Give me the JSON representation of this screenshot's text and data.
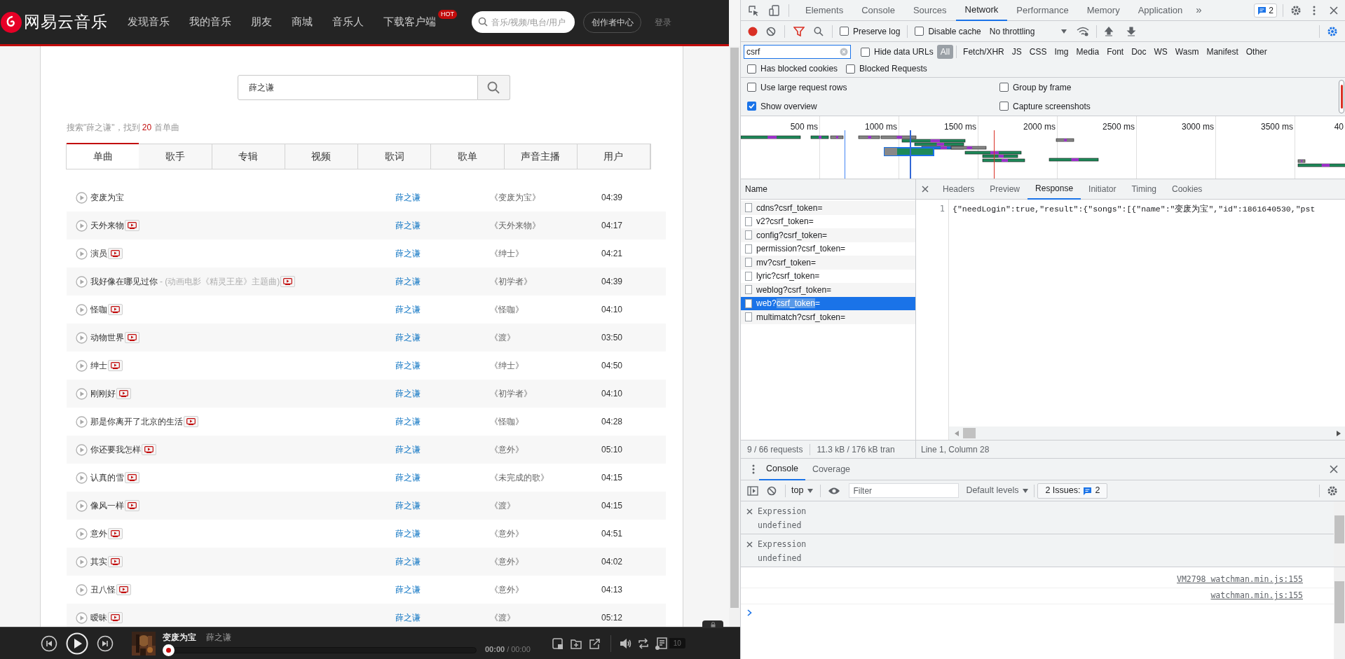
{
  "music_site": {
    "logo": "网易云音乐",
    "nav": [
      {
        "label": "发现音乐"
      },
      {
        "label": "我的音乐"
      },
      {
        "label": "朋友"
      },
      {
        "label": "商城"
      },
      {
        "label": "音乐人"
      },
      {
        "label": "下载客户端",
        "badge": "HOT"
      }
    ],
    "search_placeholder": "音乐/视频/电台/用户",
    "creator_button": "创作者中心",
    "login": "登录"
  },
  "search": {
    "value": "薛之谦",
    "summary_before": "搜索\"薛之谦\"，找到",
    "count": "20",
    "summary_after": "首单曲"
  },
  "result_tabs": [
    {
      "label": "单曲",
      "selected": true
    },
    {
      "label": "歌手",
      "selected": false
    },
    {
      "label": "专辑",
      "selected": false
    },
    {
      "label": "视频",
      "selected": false
    },
    {
      "label": "歌词",
      "selected": false
    },
    {
      "label": "歌单",
      "selected": false
    },
    {
      "label": "声音主播",
      "selected": false
    },
    {
      "label": "用户",
      "selected": false
    }
  ],
  "songs": [
    {
      "name": "变废为宝",
      "mv": false,
      "artist": "薛之谦",
      "album": "《变废为宝》",
      "duration": "04:39"
    },
    {
      "name": "天外来物",
      "mv": true,
      "artist": "薛之谦",
      "album": "《天外来物》",
      "duration": "04:17"
    },
    {
      "name": "演员",
      "mv": true,
      "artist": "薛之谦",
      "album": "《绅士》",
      "duration": "04:21"
    },
    {
      "name": "我好像在哪见过你",
      "note": "- (动画电影《精灵王座》主题曲)",
      "mv": true,
      "artist": "薛之谦",
      "album": "《初学者》",
      "duration": "04:39"
    },
    {
      "name": "怪咖",
      "mv": true,
      "artist": "薛之谦",
      "album": "《怪咖》",
      "duration": "04:10"
    },
    {
      "name": "动物世界",
      "mv": true,
      "artist": "薛之谦",
      "album": "《渡》",
      "duration": "03:50"
    },
    {
      "name": "绅士",
      "mv": true,
      "artist": "薛之谦",
      "album": "《绅士》",
      "duration": "04:50"
    },
    {
      "name": "刚刚好",
      "mv": true,
      "artist": "薛之谦",
      "album": "《初学者》",
      "duration": "04:10"
    },
    {
      "name": "那是你离开了北京的生活",
      "mv": true,
      "artist": "薛之谦",
      "album": "《怪咖》",
      "duration": "04:28"
    },
    {
      "name": "你还要我怎样",
      "mv": true,
      "artist": "薛之谦",
      "album": "《意外》",
      "duration": "05:10"
    },
    {
      "name": "认真的雪",
      "mv": true,
      "artist": "薛之谦",
      "album": "《未完成的歌》",
      "duration": "04:15"
    },
    {
      "name": "像风一样",
      "mv": true,
      "artist": "薛之谦",
      "album": "《渡》",
      "duration": "04:15"
    },
    {
      "name": "意外",
      "mv": true,
      "artist": "薛之谦",
      "album": "《意外》",
      "duration": "04:51"
    },
    {
      "name": "其实",
      "mv": true,
      "artist": "薛之谦",
      "album": "《意外》",
      "duration": "04:02"
    },
    {
      "name": "丑八怪",
      "mv": true,
      "artist": "薛之谦",
      "album": "《意外》",
      "duration": "04:13"
    },
    {
      "name": "暧昧",
      "mv": true,
      "artist": "薛之谦",
      "album": "《渡》",
      "duration": "05:12"
    }
  ],
  "player": {
    "title": "变废为宝",
    "artist": "薛之谦",
    "level": 0,
    "time_elapsed": "00:00",
    "time_total": "/ 00:00",
    "playlist_count": "10"
  },
  "devtools": {
    "tabs": [
      {
        "label": "Elements",
        "selected": false
      },
      {
        "label": "Console",
        "selected": false
      },
      {
        "label": "Sources",
        "selected": false
      },
      {
        "label": "Network",
        "selected": true
      },
      {
        "label": "Performance",
        "selected": false
      },
      {
        "label": "Memory",
        "selected": false
      },
      {
        "label": "Application",
        "selected": false
      }
    ],
    "more": "»",
    "issues_count": "2",
    "preserve_log": {
      "label": "Preserve log",
      "checked": false
    },
    "disable_cache": {
      "label": "Disable cache",
      "checked": false
    },
    "throttling": "No throttling",
    "filter": "csrf",
    "hide_data_urls": {
      "label": "Hide data URLs",
      "checked": false
    },
    "types": [
      {
        "label": "All",
        "selected": true
      },
      {
        "label": "Fetch/XHR",
        "selected": false
      },
      {
        "label": "JS",
        "selected": false
      },
      {
        "label": "CSS",
        "selected": false
      },
      {
        "label": "Img",
        "selected": false
      },
      {
        "label": "Media",
        "selected": false
      },
      {
        "label": "Font",
        "selected": false
      },
      {
        "label": "Doc",
        "selected": false
      },
      {
        "label": "WS",
        "selected": false
      },
      {
        "label": "Wasm",
        "selected": false
      },
      {
        "label": "Manifest",
        "selected": false
      },
      {
        "label": "Other",
        "selected": false
      }
    ],
    "has_blocked_cookies": {
      "label": "Has blocked cookies",
      "checked": false
    },
    "blocked_requests": {
      "label": "Blocked Requests",
      "checked": false
    },
    "options": [
      {
        "label": "Use large request rows",
        "checked": false
      },
      {
        "label": "Group by frame",
        "checked": false
      },
      {
        "label": "Show overview",
        "checked": true
      },
      {
        "label": "Capture screenshots",
        "checked": false
      }
    ],
    "timeline_ticks": [
      "500 ms",
      "1000 ms",
      "1500 ms",
      "2000 ms",
      "2500 ms",
      "3000 ms",
      "3500 ms",
      "40"
    ],
    "name_header": "Name",
    "requests": [
      {
        "name": "cdns?csrf_token=",
        "selected": false
      },
      {
        "name": "v2?csrf_token=",
        "selected": false
      },
      {
        "name": "config?csrf_token=",
        "selected": false
      },
      {
        "name": "permission?csrf_token=",
        "selected": false
      },
      {
        "name": "mv?csrf_token=",
        "selected": false
      },
      {
        "name": "lyric?csrf_token=",
        "selected": false
      },
      {
        "name": "weblog?csrf_token=",
        "selected": false
      },
      {
        "name": "web?",
        "match": "csrf_token",
        "name_end": "=",
        "selected": true
      },
      {
        "name": "multimatch?csrf_token=",
        "selected": false
      }
    ],
    "detail_tabs": [
      {
        "label": "Headers",
        "selected": false
      },
      {
        "label": "Preview",
        "selected": false
      },
      {
        "label": "Response",
        "selected": true
      },
      {
        "label": "Initiator",
        "selected": false
      },
      {
        "label": "Timing",
        "selected": false
      },
      {
        "label": "Cookies",
        "selected": false
      }
    ],
    "response": {
      "line_number": "1",
      "text": "{\"needLogin\":true,\"result\":{\"songs\":[{\"name\":\"变废为宝\",\"id\":1861640530,\"pst"
    },
    "status": {
      "requests": "9 / 66 requests",
      "transferred": "11.3 kB / 176 kB tran",
      "cursor": "Line 1, Column 28"
    },
    "drawer": {
      "tabs": [
        {
          "label": "Console",
          "selected": true
        },
        {
          "label": "Coverage",
          "selected": false
        }
      ],
      "context": "top",
      "filter_placeholder": "Filter",
      "levels": "Default levels",
      "issues_label": "2 Issues:",
      "issues_count": "2",
      "expressions": [
        {
          "label": "Expression",
          "value": "undefined"
        },
        {
          "label": "Expression",
          "value": "undefined"
        }
      ],
      "log_links": [
        "VM2798 watchman.min.js:155",
        "watchman.min.js:155"
      ]
    }
  }
}
